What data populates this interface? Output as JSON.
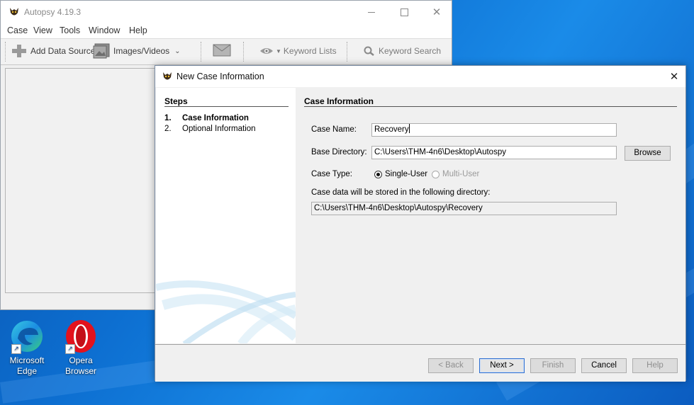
{
  "main_window": {
    "title": "Autopsy 4.19.3",
    "menu": [
      "Case",
      "View",
      "Tools",
      "Window",
      "Help"
    ],
    "toolbar": {
      "add_data_source": "Add Data Source",
      "images_videos": "Images/Videos",
      "keyword_lists": "Keyword Lists",
      "keyword_search": "Keyword Search"
    }
  },
  "dialog": {
    "title": "New Case Information",
    "steps_header": "Steps",
    "steps": [
      {
        "num": "1.",
        "label": "Case Information",
        "active": true
      },
      {
        "num": "2.",
        "label": "Optional Information",
        "active": false
      }
    ],
    "section_header": "Case Information",
    "case_name_label": "Case Name:",
    "case_name_value": "Recovery",
    "base_dir_label": "Base Directory:",
    "base_dir_value": "C:\\Users\\THM-4n6\\Desktop\\Autospy",
    "browse_label": "Browse",
    "case_type_label": "Case Type:",
    "single_user_label": "Single-User",
    "multi_user_label": "Multi-User",
    "storage_note": "Case data will be stored in the following directory:",
    "storage_path": "C:\\Users\\THM-4n6\\Desktop\\Autospy\\Recovery",
    "buttons": {
      "back": "< Back",
      "next": "Next >",
      "finish": "Finish",
      "cancel": "Cancel",
      "help": "Help"
    }
  },
  "desktop_icons": [
    {
      "name": "Microsoft\nEdge",
      "line1": "Microsoft",
      "line2": "Edge"
    },
    {
      "name": "Opera\nBrowser",
      "line1": "Opera",
      "line2": "Browser"
    }
  ],
  "colors": {
    "desktop_blue": "#0d6fd1",
    "dialog_bg": "#f0f0f0",
    "default_button_border": "#2f6fd0"
  }
}
